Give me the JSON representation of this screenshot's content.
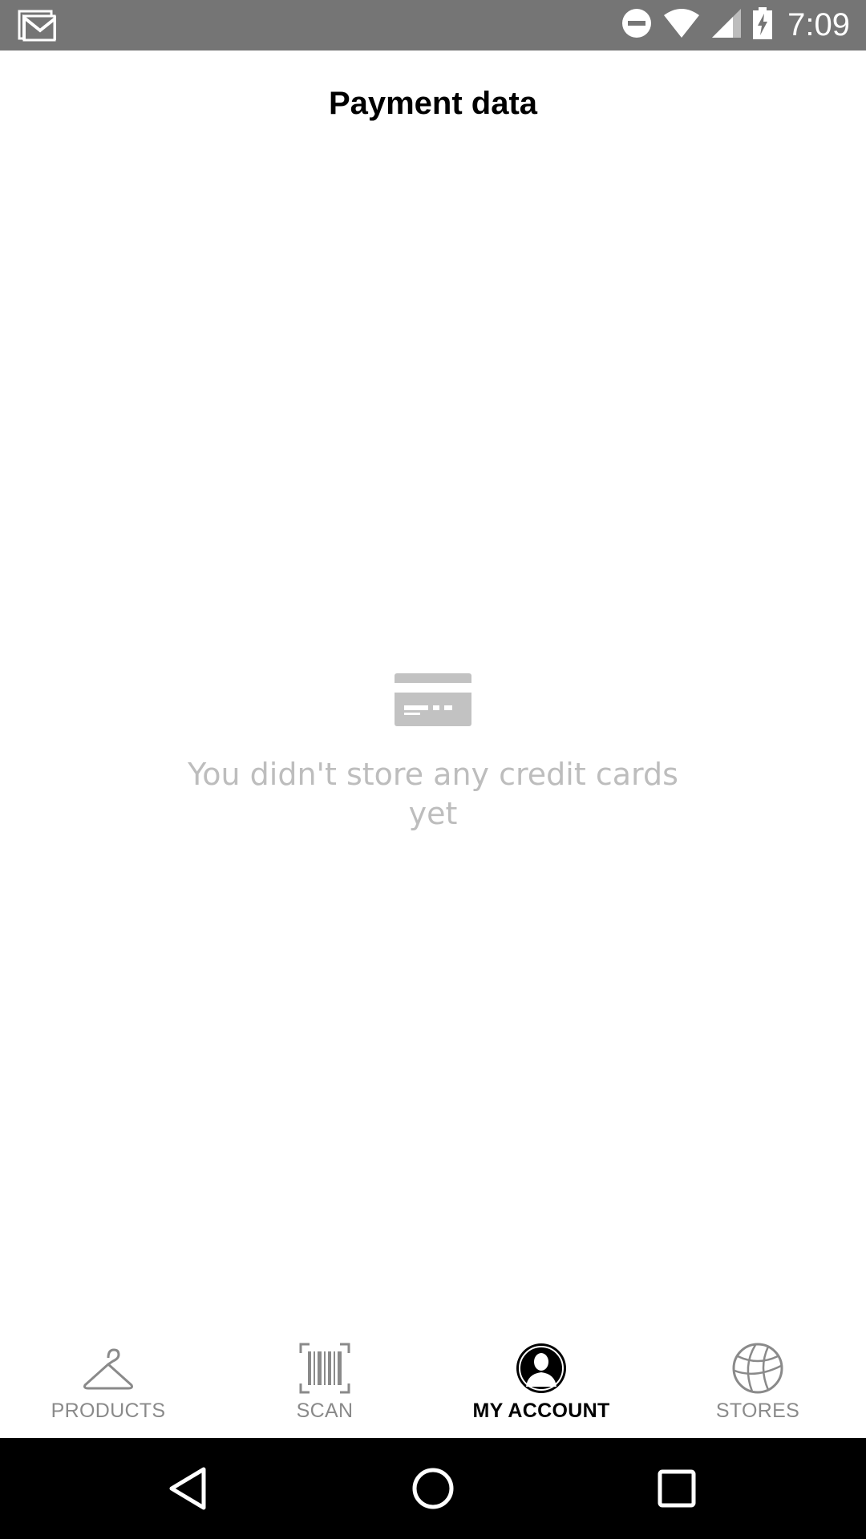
{
  "status_bar": {
    "time": "7:09",
    "icons": [
      "gmail-icon",
      "do-not-disturb-icon",
      "wifi-icon",
      "cell-signal-icon",
      "battery-charging-icon"
    ]
  },
  "header": {
    "title": "Payment data"
  },
  "empty_state": {
    "icon": "credit-card-icon",
    "message": "You didn't store any credit cards yet"
  },
  "bottom_nav": {
    "items": [
      {
        "label": "PRODUCTS",
        "icon": "hanger-icon",
        "active": false
      },
      {
        "label": "SCAN",
        "icon": "barcode-scan-icon",
        "active": false
      },
      {
        "label": "MY ACCOUNT",
        "icon": "account-icon",
        "active": true
      },
      {
        "label": "STORES",
        "icon": "globe-icon",
        "active": false
      }
    ]
  },
  "system_nav": {
    "buttons": [
      "back-icon",
      "home-icon",
      "recents-icon"
    ]
  },
  "colors": {
    "status_bar_bg": "#757575",
    "empty_text": "#bdbdbd",
    "nav_inactive": "#8a8a8a",
    "nav_active": "#000000",
    "system_nav_bg": "#000000"
  }
}
